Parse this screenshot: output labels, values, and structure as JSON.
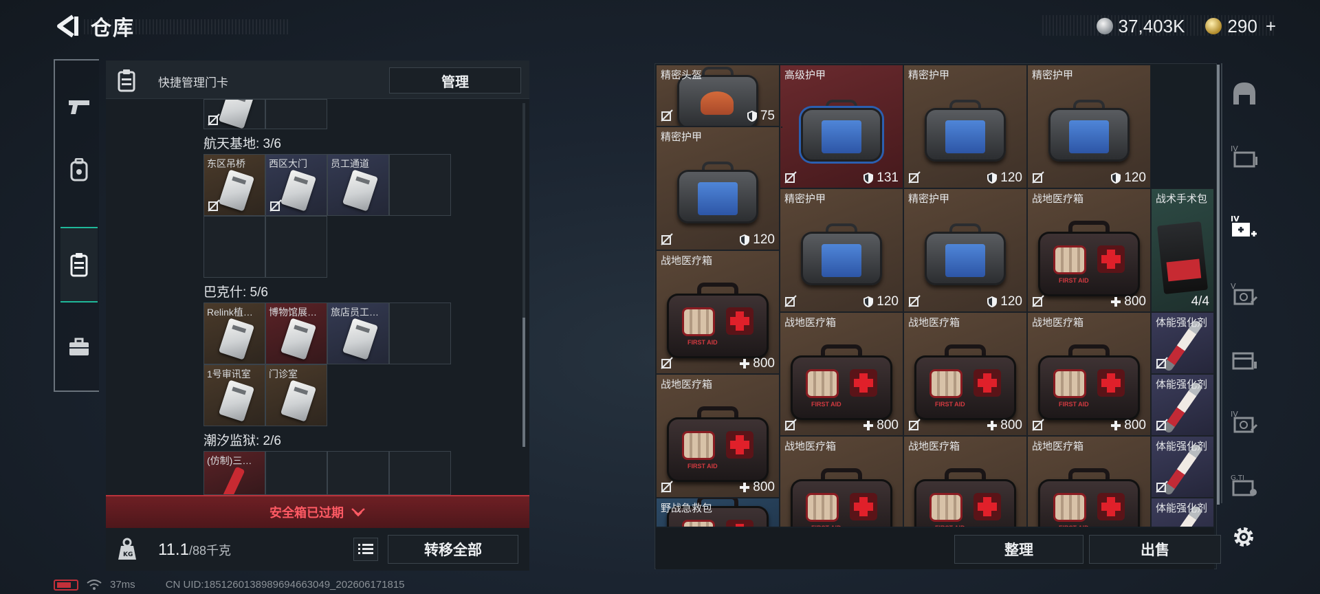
{
  "header": {
    "title": "仓库",
    "currency_1": "37,403K",
    "currency_2": "290",
    "currency_2_plus": "+"
  },
  "left_tabs": [
    {
      "icon": "pistol-icon"
    },
    {
      "icon": "backpack-icon"
    },
    {
      "icon": "keycard-case-icon",
      "active": true
    },
    {
      "icon": "briefcase-icon"
    }
  ],
  "left_panel": {
    "title": "快捷管理门卡",
    "manage_button": "管理",
    "sections": [
      {
        "title": "航天基地: 3/6",
        "cards": [
          "东区吊桥",
          "西区大门",
          "员工通道"
        ]
      },
      {
        "title": "巴克什: 5/6",
        "cards": [
          "Relink植…",
          "博物馆展…",
          "旅店员工…",
          "1号审讯室",
          "门诊室"
        ]
      },
      {
        "title": "潮汐监狱: 2/6",
        "cards": [
          "(仿制)三…"
        ]
      }
    ],
    "expired_text": "安全箱已过期",
    "weight": "11.1",
    "weight_max": "/88千克",
    "transfer_button": "转移全部"
  },
  "status": {
    "ping": "37ms",
    "uid": "CN UID:1851260138989694663049_202606171815"
  },
  "items": [
    {
      "name": "精密头盔",
      "value": "75",
      "kind": "helmet",
      "color": "brown",
      "icon": "shield"
    },
    {
      "name": "高级护甲",
      "value": "131",
      "kind": "armor-big",
      "color": "red",
      "icon": "shield"
    },
    {
      "name": "精密护甲",
      "value": "120",
      "kind": "armor",
      "color": "brown",
      "icon": "shield"
    },
    {
      "name": "精密护甲",
      "value": "120",
      "kind": "armor",
      "color": "brown",
      "icon": "shield"
    },
    {
      "name": "精密护甲",
      "value": "120",
      "kind": "armor",
      "color": "brown",
      "icon": "shield"
    },
    {
      "name": "体能强化剂",
      "value": "",
      "kind": "syringe",
      "color": "purple"
    },
    {
      "name": "精密护甲",
      "value": "120",
      "kind": "armor",
      "color": "brown",
      "icon": "shield"
    },
    {
      "name": "精密护甲",
      "value": "120",
      "kind": "armor",
      "color": "brown",
      "icon": "shield"
    },
    {
      "name": "战地医疗箱",
      "value": "800",
      "kind": "medkit",
      "color": "brown",
      "icon": "plus"
    },
    {
      "name": "战术手术包",
      "value": "4/4",
      "kind": "pouch",
      "color": "green"
    },
    {
      "name": "战地医疗箱",
      "value": "800",
      "kind": "medkit",
      "color": "brown",
      "icon": "plus"
    },
    {
      "name": "战地医疗箱",
      "value": "800",
      "kind": "medkit",
      "color": "brown",
      "icon": "plus"
    },
    {
      "name": "战地医疗箱",
      "value": "800",
      "kind": "medkit",
      "color": "brown",
      "icon": "plus"
    },
    {
      "name": "战地医疗箱",
      "value": "800",
      "kind": "medkit",
      "color": "brown",
      "icon": "plus"
    },
    {
      "name": "体能强化剂",
      "value": "",
      "kind": "syringe",
      "color": "purple"
    },
    {
      "name": "体能强化剂",
      "value": "",
      "kind": "syringe",
      "color": "purple"
    },
    {
      "name": "战地医疗箱",
      "value": "800",
      "kind": "medkit",
      "color": "brown",
      "icon": "plus"
    },
    {
      "name": "战地医疗箱",
      "value": "",
      "kind": "medkit",
      "color": "brown"
    },
    {
      "name": "战地医疗箱",
      "value": "",
      "kind": "medkit",
      "color": "brown"
    },
    {
      "name": "战地医疗箱",
      "value": "",
      "kind": "medkit",
      "color": "brown"
    },
    {
      "name": "体能强化剂",
      "value": "",
      "kind": "syringe",
      "color": "purple"
    },
    {
      "name": "野战急救包",
      "value": "",
      "kind": "medkit",
      "color": "blue"
    },
    {
      "name": "体能强化剂",
      "value": "",
      "kind": "syringe",
      "color": "purple"
    }
  ],
  "right_sidebar": [
    "helmet-slot-icon",
    "case-iv-icon",
    "medical-iv-icon",
    "case-v-icon",
    "case-locked-icon",
    "case-iv-locked-icon",
    "case-gti-icon"
  ],
  "bottom_buttons": {
    "sort": "整理",
    "sell": "出售"
  },
  "colors": {
    "accent": "#1fb89a",
    "danger": "#ff5a64",
    "brown_slot": "#5a4636",
    "red_slot": "#6a2a2e",
    "purple_slot": "#3b3c5a",
    "green_slot": "#2d4a44"
  }
}
